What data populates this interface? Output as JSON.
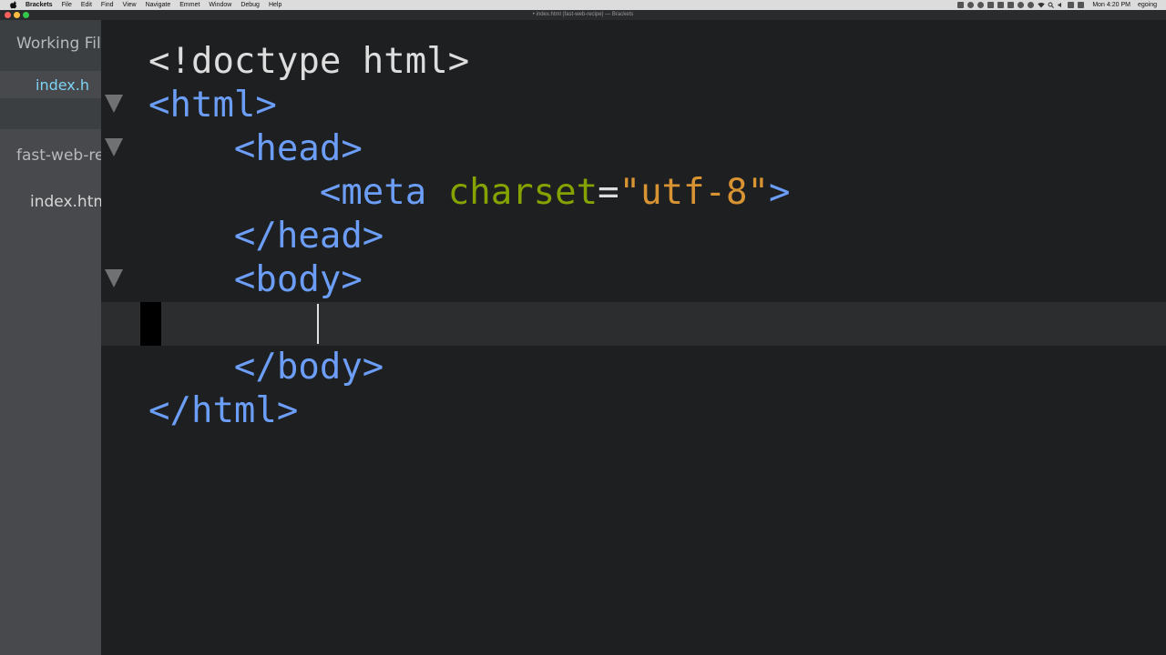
{
  "menubar": {
    "app_name": "Brackets",
    "items": [
      "File",
      "Edit",
      "Find",
      "View",
      "Navigate",
      "Emmet",
      "Window",
      "Debug",
      "Help"
    ],
    "clock": "Mon 4:20 PM",
    "user": "egoing"
  },
  "window": {
    "title": "• index.html (fast-web-recipe) — Brackets"
  },
  "sidebar": {
    "working_files_header": "Working Fil",
    "working_files": [
      "index.h"
    ],
    "project_name": "fast-web-re",
    "project_files": [
      "index.htm"
    ]
  },
  "editor": {
    "lines": [
      {
        "tokens": [
          {
            "t": "punc",
            "v": "<!doctype html>"
          }
        ]
      },
      {
        "tokens": [
          {
            "t": "tag",
            "v": "<html>"
          }
        ]
      },
      {
        "tokens": [
          {
            "t": "tag",
            "v": "    <head>"
          }
        ]
      },
      {
        "tokens": [
          {
            "t": "tag",
            "v": "        <meta "
          },
          {
            "t": "attr",
            "v": "charset"
          },
          {
            "t": "punc",
            "v": "="
          },
          {
            "t": "str",
            "v": "\"utf-8\""
          },
          {
            "t": "tag",
            "v": ">"
          }
        ]
      },
      {
        "tokens": [
          {
            "t": "tag",
            "v": "    </head>"
          }
        ]
      },
      {
        "tokens": [
          {
            "t": "tag",
            "v": "    <body>"
          }
        ]
      },
      {
        "tokens": [
          {
            "t": "punc",
            "v": "        "
          }
        ]
      },
      {
        "tokens": [
          {
            "t": "tag",
            "v": "    </body>"
          }
        ]
      },
      {
        "tokens": [
          {
            "t": "tag",
            "v": "</html>"
          }
        ]
      }
    ],
    "fold_lines": [
      1,
      2,
      5
    ],
    "active_line": 6
  },
  "colors": {
    "tag": "#6c9ef8",
    "attribute": "#85a300",
    "string": "#d89333",
    "working_file": "#7fd3f5"
  }
}
